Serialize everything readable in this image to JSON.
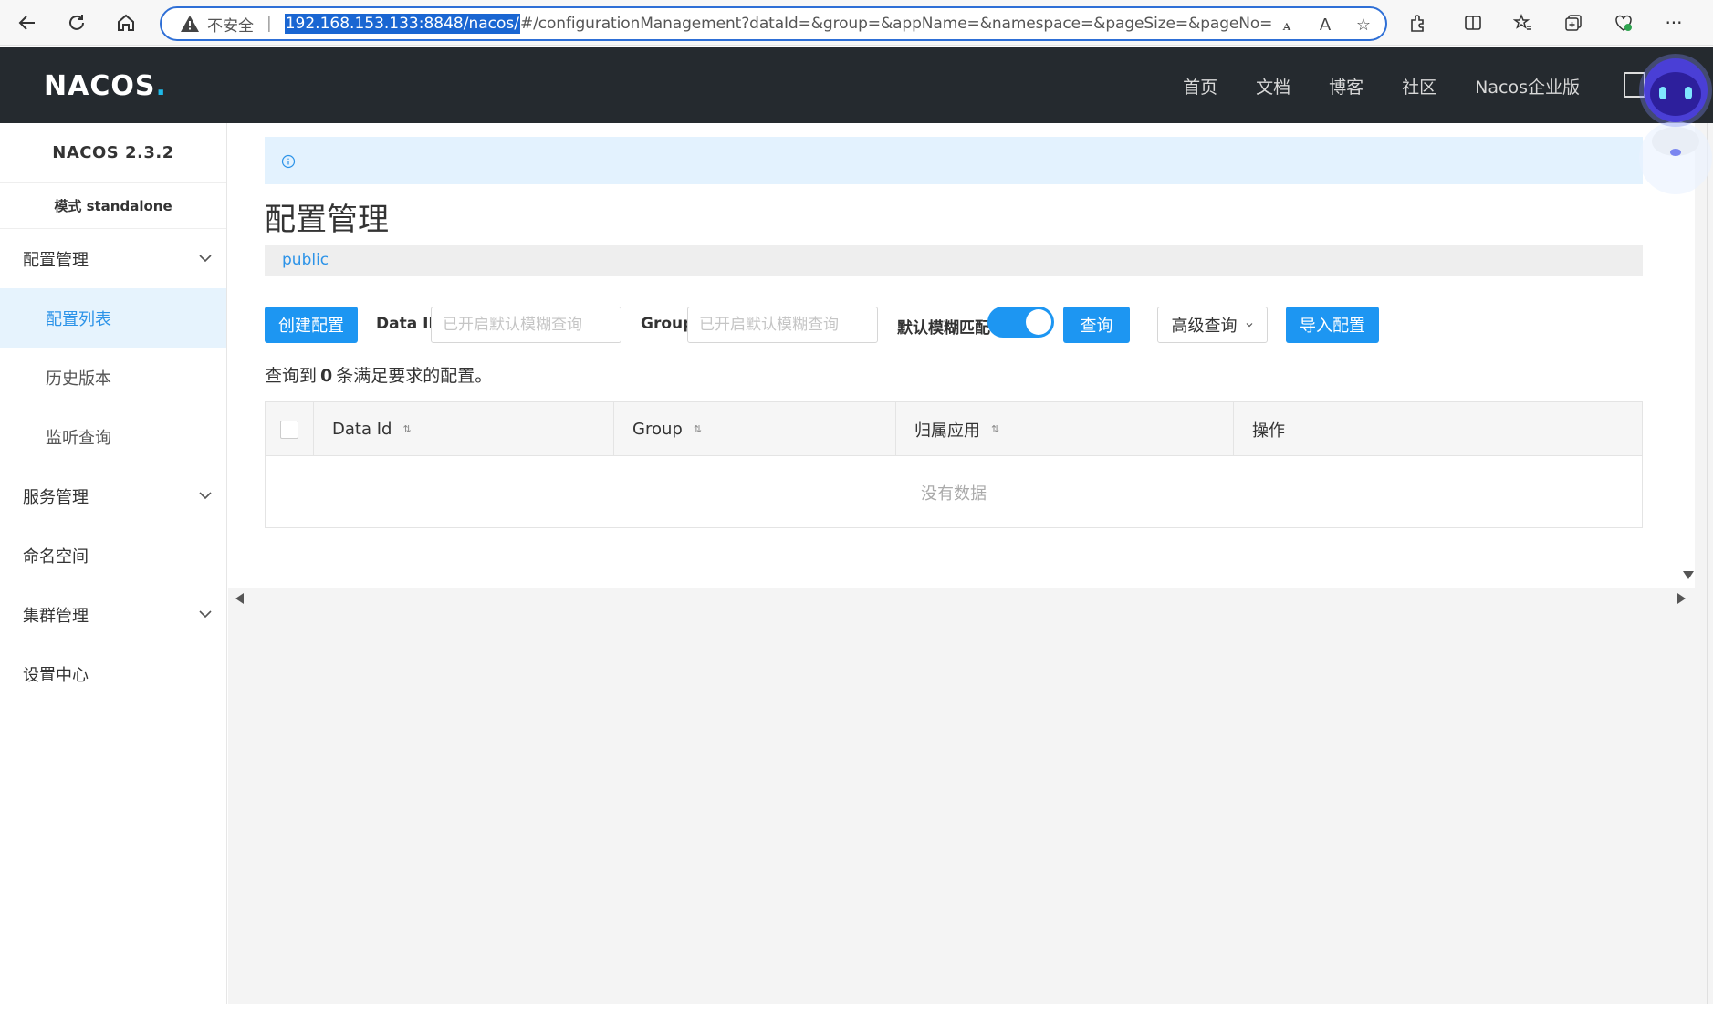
{
  "browser": {
    "insecure_label": "不安全",
    "url_selected": "192.168.153.133:8848/nacos/",
    "url_rest": "#/configurationManagement?dataId=&group=&appName=&namespace=&pageSize=&pageNo="
  },
  "header": {
    "logo": "NACOS",
    "logo_dot": ".",
    "nav": [
      "首页",
      "文档",
      "博客",
      "社区",
      "Nacos企业版"
    ]
  },
  "sidebar": {
    "version": "NACOS 2.3.2",
    "mode": "模式 standalone",
    "items": [
      {
        "label": "配置管理",
        "expandable": true
      },
      {
        "label": "配置列表",
        "active": true
      },
      {
        "label": "历史版本"
      },
      {
        "label": "监听查询"
      },
      {
        "label": "服务管理",
        "expandable": true
      },
      {
        "label": "命名空间"
      },
      {
        "label": "集群管理",
        "expandable": true
      },
      {
        "label": "设置中心"
      }
    ]
  },
  "main": {
    "title": "配置管理",
    "namespace": "public",
    "toolbar": {
      "create_label": "创建配置",
      "dataid_label": "Data ID",
      "dataid_placeholder": "已开启默认模糊查询",
      "group_label": "Group",
      "group_placeholder": "已开启默认模糊查询",
      "fuzzy_label": "默认模糊匹配",
      "fuzzy_on": true,
      "search_label": "查询",
      "advanced_label": "高级查询",
      "import_label": "导入配置"
    },
    "result": {
      "prefix": "查询到",
      "count": "0",
      "suffix": "条满足要求的配置。"
    },
    "table": {
      "columns": [
        "Data Id",
        "Group",
        "归属应用",
        "操作"
      ],
      "empty_text": "没有数据"
    }
  },
  "colors": {
    "primary": "#1d96f2",
    "header_bg": "#252a2f",
    "active_bg": "#e6f3fd"
  }
}
